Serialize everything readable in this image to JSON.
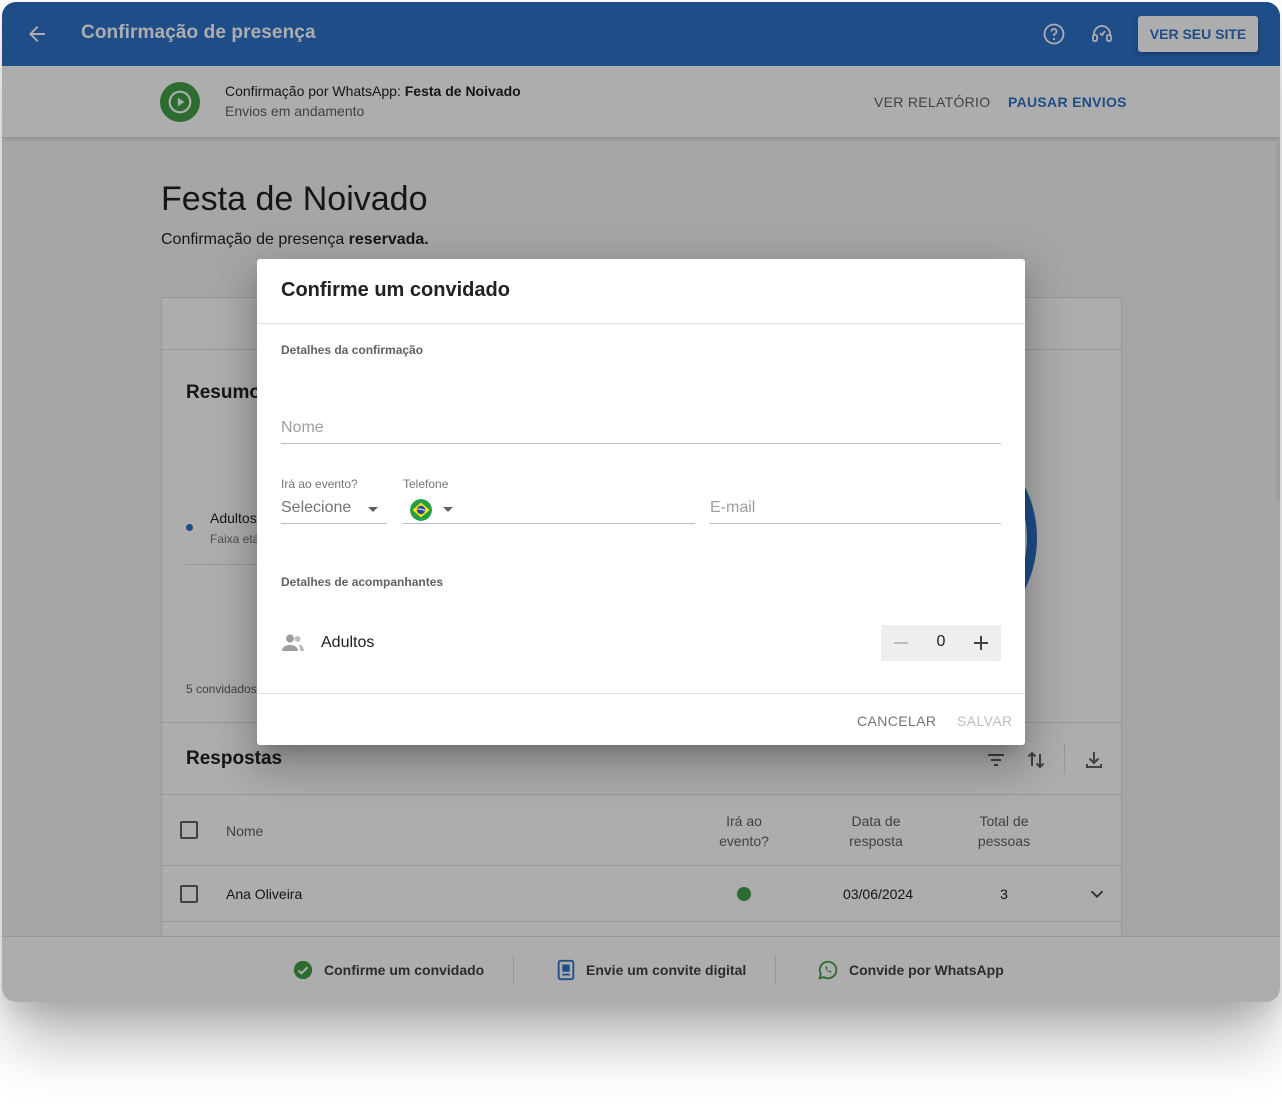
{
  "appbar": {
    "title": "Confirmação de presença",
    "site_button": "VER SEU SITE",
    "color": "#2d72c9"
  },
  "status": {
    "prefix": "Confirmação por WhatsApp:",
    "event_name": "Festa de Noivado",
    "state": "Envios em andamento",
    "report_button": "VER RELATÓRIO",
    "pause_button": "PAUSAR ENVIOS"
  },
  "page": {
    "title": "Festa de Noivado",
    "subtitle_prefix": "Confirmação de presença",
    "subtitle_bold": "reservada."
  },
  "summary": {
    "title": "Resumo",
    "legend_label": "Adultos",
    "legend_sub": "Faixa etá",
    "guest_count": "5 convidados"
  },
  "responses": {
    "title": "Respostas",
    "columns": {
      "name": "Nome",
      "attending_1": "Irá ao",
      "attending_2": "evento?",
      "date_1": "Data de",
      "date_2": "resposta",
      "total_1": "Total de",
      "total_2": "pessoas"
    },
    "rows": [
      {
        "name": "Ana Oliveira",
        "date": "03/06/2024",
        "total": "3"
      }
    ]
  },
  "bottombar": {
    "confirm": "Confirme um convidado",
    "invite": "Envie um convite digital",
    "whatsapp": "Convide por WhatsApp"
  },
  "dialog": {
    "title": "Confirme um convidado",
    "section_details": "Detalhes da confirmação",
    "name_placeholder": "Nome",
    "attending_label": "Irá ao evento?",
    "attending_value": "Selecione",
    "phone_label": "Telefone",
    "email_placeholder": "E-mail",
    "section_companions": "Detalhes de acompanhantes",
    "adults_label": "Adultos",
    "adults_value": "0",
    "cancel": "CANCELAR",
    "save": "SALVAR"
  }
}
